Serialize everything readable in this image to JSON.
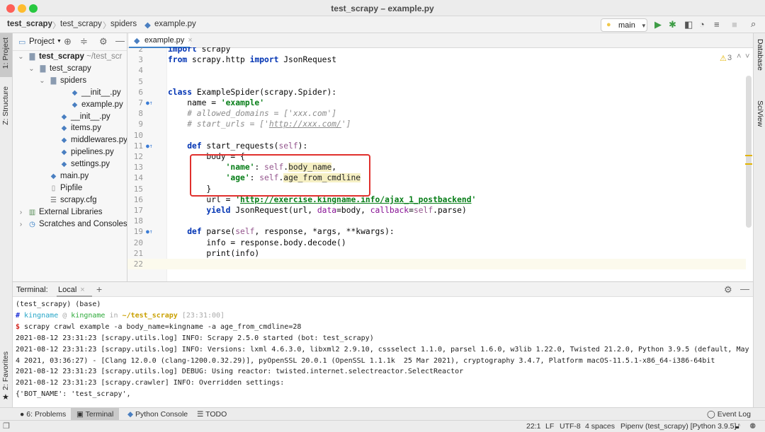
{
  "window": {
    "title": "test_scrapy – example.py"
  },
  "breadcrumb": [
    "test_scrapy",
    "test_scrapy",
    "spiders",
    "example.py"
  ],
  "toolbar": {
    "run_config": "main"
  },
  "left_strip": {
    "project": "1: Project",
    "structure": "Z: Structure",
    "favorites": "2: Favorites"
  },
  "right_strip": {
    "database": "Database",
    "sciview": "SciView"
  },
  "project": {
    "title": "Project",
    "tree": [
      {
        "label": "test_scrapy",
        "suffix": " ~/test_scr",
        "depth": 0,
        "icon": "folder",
        "arrow": "v",
        "bold": true
      },
      {
        "label": "test_scrapy",
        "depth": 1,
        "icon": "folder",
        "arrow": "v"
      },
      {
        "label": "spiders",
        "depth": 2,
        "icon": "folder",
        "arrow": "v"
      },
      {
        "label": "__init__.py",
        "depth": 4,
        "icon": "python-file"
      },
      {
        "label": "example.py",
        "depth": 4,
        "icon": "python-file"
      },
      {
        "label": "__init__.py",
        "depth": 3,
        "icon": "python-file"
      },
      {
        "label": "items.py",
        "depth": 3,
        "icon": "python-file"
      },
      {
        "label": "middlewares.py",
        "depth": 3,
        "icon": "python-file"
      },
      {
        "label": "pipelines.py",
        "depth": 3,
        "icon": "python-file"
      },
      {
        "label": "settings.py",
        "depth": 3,
        "icon": "python-file"
      },
      {
        "label": "main.py",
        "depth": 2,
        "icon": "python-file"
      },
      {
        "label": "Pipfile",
        "depth": 2,
        "icon": "pipfile"
      },
      {
        "label": "scrapy.cfg",
        "depth": 2,
        "icon": "config-file"
      },
      {
        "label": "External Libraries",
        "depth": 0,
        "icon": "library",
        "arrow": ">"
      },
      {
        "label": "Scratches and Consoles",
        "depth": 0,
        "icon": "scratches",
        "arrow": ">"
      }
    ]
  },
  "editor": {
    "tab": "example.py",
    "warnings": "3",
    "lines": [
      {
        "n": "2",
        "t": [
          [
            "kw",
            "import"
          ],
          [
            "pl",
            " scrapy"
          ]
        ]
      },
      {
        "n": "3",
        "t": [
          [
            "kw",
            "from"
          ],
          [
            "pl",
            " scrapy.http "
          ],
          [
            "kw",
            "import"
          ],
          [
            "pl",
            " JsonRequest"
          ]
        ]
      },
      {
        "n": "4",
        "t": []
      },
      {
        "n": "5",
        "t": []
      },
      {
        "n": "6",
        "t": [
          [
            "kw",
            "class"
          ],
          [
            "pl",
            " ExampleSpider(scrapy.Spider):"
          ]
        ]
      },
      {
        "n": "7",
        "m": true,
        "t": [
          [
            "pl",
            "    name = "
          ],
          [
            "str",
            "'example'"
          ]
        ]
      },
      {
        "n": "8",
        "t": [
          [
            "cm",
            "    # allowed_domains = ['xxx.com']"
          ]
        ]
      },
      {
        "n": "9",
        "t": [
          [
            "cm",
            "    # start_urls = ['"
          ],
          [
            "cmu",
            "http://xxx.com/"
          ],
          [
            "cm",
            "']"
          ]
        ]
      },
      {
        "n": "10",
        "t": []
      },
      {
        "n": "11",
        "m": true,
        "t": [
          [
            "pl",
            "    "
          ],
          [
            "kw",
            "def"
          ],
          [
            "pl",
            " start_requests("
          ],
          [
            "self",
            "self"
          ],
          [
            "pl",
            "):"
          ]
        ]
      },
      {
        "n": "12",
        "t": [
          [
            "pl",
            "        body = {"
          ]
        ]
      },
      {
        "n": "13",
        "t": [
          [
            "pl",
            "            "
          ],
          [
            "str",
            "'name'"
          ],
          [
            "pl",
            ": "
          ],
          [
            "self",
            "self"
          ],
          [
            "pl",
            "."
          ],
          [
            "hl",
            "body_name"
          ],
          [
            "pl",
            ","
          ]
        ]
      },
      {
        "n": "14",
        "t": [
          [
            "pl",
            "            "
          ],
          [
            "str",
            "'age'"
          ],
          [
            "pl",
            ": "
          ],
          [
            "self",
            "self"
          ],
          [
            "pl",
            "."
          ],
          [
            "hl",
            "age_from_cmdline"
          ]
        ]
      },
      {
        "n": "15",
        "t": [
          [
            "pl",
            "        }"
          ]
        ]
      },
      {
        "n": "16",
        "t": [
          [
            "pl",
            "        url = "
          ],
          [
            "str",
            "'"
          ],
          [
            "url",
            "http://exercise.kingname.info/ajax_1_postbackend"
          ],
          [
            "str",
            "'"
          ]
        ]
      },
      {
        "n": "17",
        "t": [
          [
            "pl",
            "        "
          ],
          [
            "kw",
            "yield"
          ],
          [
            "pl",
            " JsonRequest(url, "
          ],
          [
            "param",
            "data"
          ],
          [
            "pl",
            "=body, "
          ],
          [
            "param",
            "callback"
          ],
          [
            "pl",
            "="
          ],
          [
            "self",
            "self"
          ],
          [
            "pl",
            ".parse)"
          ]
        ]
      },
      {
        "n": "18",
        "t": []
      },
      {
        "n": "19",
        "m": true,
        "t": [
          [
            "pl",
            "    "
          ],
          [
            "kw",
            "def"
          ],
          [
            "pl",
            " parse("
          ],
          [
            "self",
            "self"
          ],
          [
            "pl",
            ", response, *args, **kwargs):"
          ]
        ]
      },
      {
        "n": "20",
        "t": [
          [
            "pl",
            "        info = response.body.decode()"
          ]
        ]
      },
      {
        "n": "21",
        "t": [
          [
            "pl",
            "        print(info)"
          ]
        ]
      },
      {
        "n": "22",
        "t": []
      }
    ]
  },
  "terminal": {
    "label": "Terminal:",
    "tab": "Local",
    "lines": [
      [
        [
          "t-pl",
          "(test_scrapy) (base)"
        ]
      ],
      [
        [
          "t-hash",
          "# "
        ],
        [
          "t-user",
          "kingname"
        ],
        [
          "t-dim",
          " @ "
        ],
        [
          "t-host",
          "kingname"
        ],
        [
          "t-dim",
          " in "
        ],
        [
          "t-dir",
          "~/test_scrapy"
        ],
        [
          "t-dim",
          " [23:31:00]"
        ]
      ],
      [
        [
          "t-dollar",
          "$ "
        ],
        [
          "t-pl",
          "scrapy crawl example -a body_name=kingname -a age_from_cmdline=28"
        ]
      ],
      [
        [
          "t-pl",
          "2021-08-12 23:31:23 [scrapy.utils.log] INFO: Scrapy 2.5.0 started (bot: test_scrapy)"
        ]
      ],
      [
        [
          "t-pl",
          "2021-08-12 23:31:23 [scrapy.utils.log] INFO: Versions: lxml 4.6.3.0, libxml2 2.9.10, cssselect 1.1.0, parsel 1.6.0, w3lib 1.22.0, Twisted 21.2.0, Python 3.9.5 (default, May"
        ]
      ],
      [
        [
          "t-pl",
          "4 2021, 03:36:27) - [Clang 12.0.0 (clang-1200.0.32.29)], pyOpenSSL 20.0.1 (OpenSSL 1.1.1k  25 Mar 2021), cryptography 3.4.7, Platform macOS-11.5.1-x86_64-i386-64bit"
        ]
      ],
      [
        [
          "t-pl",
          "2021-08-12 23:31:23 [scrapy.utils.log] DEBUG: Using reactor: twisted.internet.selectreactor.SelectReactor"
        ]
      ],
      [
        [
          "t-pl",
          "2021-08-12 23:31:23 [scrapy.crawler] INFO: Overridden settings:"
        ]
      ],
      [
        [
          "t-pl",
          "{'BOT_NAME': 'test_scrapy',"
        ]
      ]
    ]
  },
  "tool_windows": {
    "problems": "6: Problems",
    "terminal": "Terminal",
    "python_console": "Python Console",
    "todo": "TODO",
    "event_log": "Event Log"
  },
  "status": {
    "position": "22:1",
    "line_sep": "LF",
    "encoding": "UTF-8",
    "indent": "4 spaces",
    "interpreter": "Pipenv (test_scrapy) [Python 3.9.5]"
  }
}
